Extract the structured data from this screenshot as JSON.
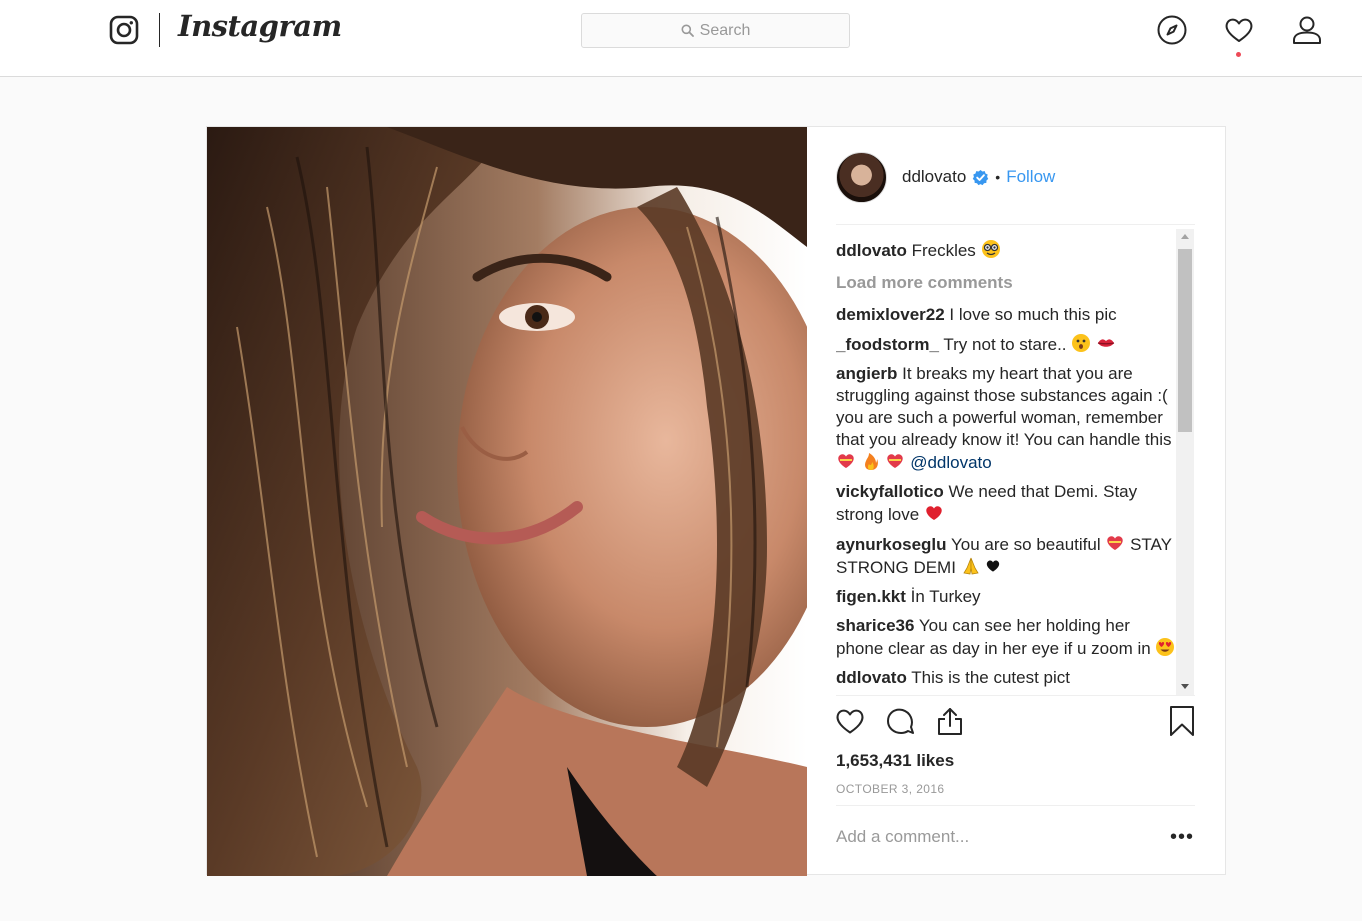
{
  "brand": {
    "wordmark": "Instagram"
  },
  "search": {
    "placeholder": "Search"
  },
  "nav": {
    "icons": [
      "compass-icon",
      "heart-icon",
      "profile-icon"
    ],
    "has_notification": true
  },
  "post": {
    "username": "ddlovato",
    "verified": true,
    "separator": "•",
    "follow_label": "Follow",
    "caption": {
      "user": "ddlovato",
      "text": "Freckles",
      "emoji": "nerd-face"
    },
    "load_more_label": "Load more comments",
    "comments": [
      {
        "user": "demixlover22",
        "text": "I love so much this pic"
      },
      {
        "user": "_foodstorm_",
        "text": "Try not to stare..",
        "emoji": [
          "hushed-face",
          "kiss-mark"
        ]
      },
      {
        "user": "angierb",
        "text": "It breaks my heart that you are struggling against those substances again :( you are such a powerful woman, remember that you already know it! You can handle this",
        "emoji": [
          "heart-ribbon",
          "fire",
          "heart-ribbon"
        ],
        "mention": "@ddlovato"
      },
      {
        "user": "vickyfallotico",
        "text": "We need that Demi. Stay strong love",
        "emoji": [
          "red-heart"
        ]
      },
      {
        "user": "aynurkoseglu",
        "text_before": "You are so beautiful",
        "text_after": "STAY STRONG DEMI",
        "emoji": [
          "heart-ribbon",
          "folded-hands",
          "black-heart"
        ]
      },
      {
        "user": "figen.kkt",
        "text": "İn Turkey"
      },
      {
        "user": "sharice36",
        "text": "You can see her holding her phone clear as day in her eye if u zoom in",
        "emoji": [
          "heart-eyes"
        ]
      },
      {
        "user": "ddlovato",
        "text": "This is the cutest pict"
      }
    ],
    "likes_label": "1,653,431 likes",
    "date_label": "OCTOBER 3, 2016",
    "add_comment_placeholder": "Add a comment...",
    "more_label": "•••"
  },
  "colors": {
    "link": "#3897f0",
    "verified": "#3897f0",
    "notification": "#ed4956",
    "muted": "#999999",
    "border": "#dbdbdb"
  }
}
